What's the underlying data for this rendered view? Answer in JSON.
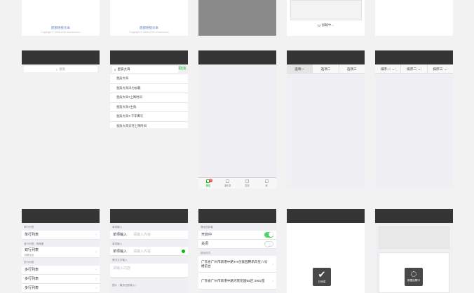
{
  "footer": {
    "link": "底部链接文本",
    "copyright": "Copyright © 2008-2016 xxxxxxxxxxx"
  },
  "loading": {
    "text": "加载中..."
  },
  "search": {
    "placeholder": "搜索",
    "query": "星辰大海",
    "cancel": "取消",
    "suggestions": [
      "星辰大海",
      "星辰大海洋力加载",
      "星辰大海7上映时间",
      "星辰大海7主角",
      "星辰大海7-千年鹰号",
      "星辰大海支持上映时间"
    ]
  },
  "tabbar": {
    "items": [
      "微信",
      "通讯录",
      "发现",
      "我"
    ],
    "badge": "8"
  },
  "tabs": {
    "items": [
      "选项一",
      "选项二",
      "选项三"
    ]
  },
  "sort": {
    "items": [
      "排序一",
      "排序二",
      "排序三"
    ]
  },
  "list": {
    "group1": "单行列表",
    "row1": "单行列表",
    "group2": "双行列表 - 有摘要",
    "row2": "双行列表",
    "row2_sub": "摘要信息",
    "group3": "多行列表",
    "rows3": [
      "多行列表",
      "多行列表",
      "多行列表"
    ]
  },
  "form": {
    "group1": "单项输入",
    "label": "单项输入",
    "placeholder": "请输入内容",
    "group2": "单项输入",
    "group3": "情况文字输入",
    "textarea_ph": "请输入内容",
    "group4": "图片（最多四张输入）"
  },
  "switches": {
    "group1": "滑动选择框",
    "on_label": "开启中",
    "off_label": "关闭",
    "group2": "超出样式",
    "addr1": "广东省广州市新港中路TIT创意园腾讯白皇八号楼前台",
    "addr2": "广东省广州市新港中路河景花园B5区 2902室"
  },
  "toasts": {
    "done": "已完成",
    "loading": "数据加载中"
  },
  "colors": {
    "nav": "#353535",
    "accent": "#09bb07",
    "switch_on": "#4cd964",
    "badge": "#e64340"
  }
}
